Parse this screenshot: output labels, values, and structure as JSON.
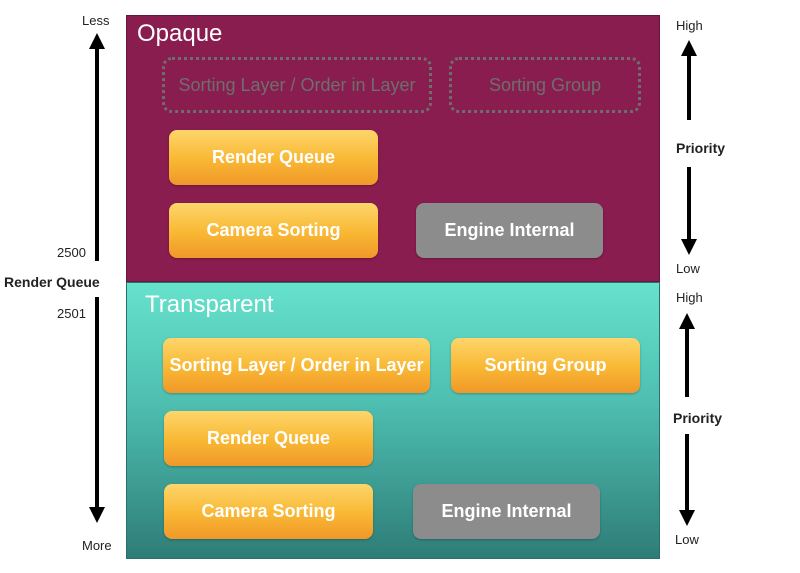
{
  "left_axis": {
    "top_label": "Less",
    "bottom_label": "More",
    "split_top_value": "2500",
    "split_bottom_value": "2501",
    "title": "Render Queue"
  },
  "opaque": {
    "title": "Opaque",
    "ghost_sorting_layer": "Sorting Layer / Order in Layer",
    "ghost_sorting_group": "Sorting Group",
    "render_queue": "Render Queue",
    "camera_sorting": "Camera Sorting",
    "engine_internal": "Engine Internal",
    "priority": {
      "high": "High",
      "label": "Priority",
      "low": "Low"
    }
  },
  "transparent": {
    "title": "Transparent",
    "sorting_layer": "Sorting Layer / Order in Layer",
    "sorting_group": "Sorting Group",
    "render_queue": "Render Queue",
    "camera_sorting": "Camera Sorting",
    "engine_internal": "Engine Internal",
    "priority": {
      "high": "High",
      "label": "Priority",
      "low": "Low"
    }
  },
  "colors": {
    "opaque_bg": "#891d4f",
    "transparent_top": "#66e2cc",
    "transparent_bottom": "#2e7d77",
    "box_orange": "#f9b733",
    "box_gray": "#8c8c8c"
  }
}
